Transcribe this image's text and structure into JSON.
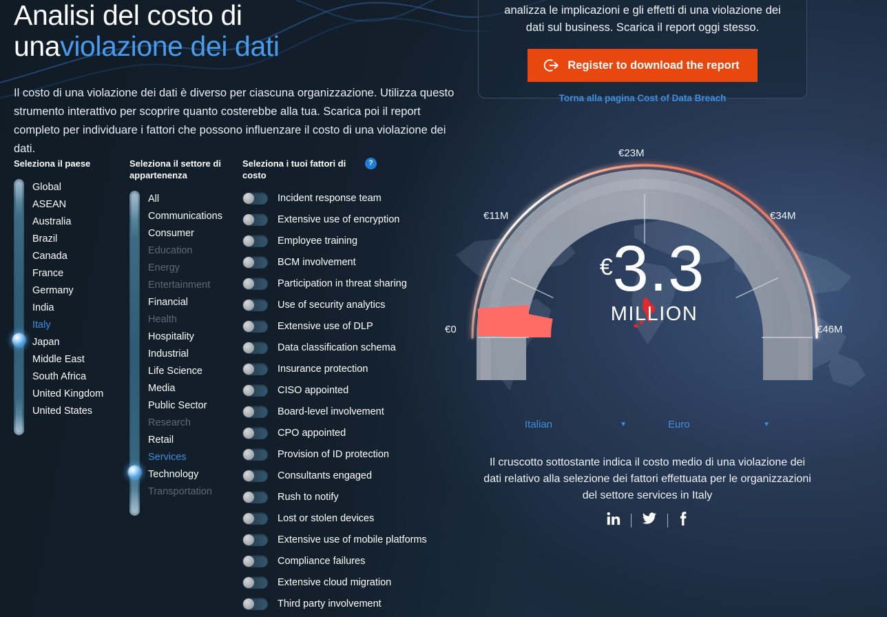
{
  "hero": {
    "title_line1": "Analisi del costo di",
    "title_line2_plain": "una",
    "title_line2_accent": "violazione dei dati",
    "lead": "Il costo di una violazione dei dati è diverso per ciascuna organizzazione. Utilizza questo strumento interattivo per scoprire quanto costerebbe alla tua. Scarica poi il report completo per individuare i fattori che possono influenzare il costo di una violazione dei dati."
  },
  "panel": {
    "text": "analizza le implicazioni e gli effetti di una violazione dei dati sul business. Scarica il report oggi stesso.",
    "button_label": "Register to download the report",
    "button_icon": "arrow-right-circle-icon",
    "button_color": "#e8470e",
    "link_label": "Torna alla pagina Cost of Data Breach",
    "link_color": "#3f8fe0"
  },
  "country": {
    "heading": "Seleziona il paese",
    "selected": "Italy",
    "items": [
      {
        "label": "Global",
        "state": "normal"
      },
      {
        "label": "ASEAN",
        "state": "normal"
      },
      {
        "label": "Australia",
        "state": "normal"
      },
      {
        "label": "Brazil",
        "state": "normal"
      },
      {
        "label": "Canada",
        "state": "normal"
      },
      {
        "label": "France",
        "state": "normal"
      },
      {
        "label": "Germany",
        "state": "normal"
      },
      {
        "label": "India",
        "state": "normal"
      },
      {
        "label": "Italy",
        "state": "selected"
      },
      {
        "label": "Japan",
        "state": "normal"
      },
      {
        "label": "Middle East",
        "state": "normal"
      },
      {
        "label": "South Africa",
        "state": "normal"
      },
      {
        "label": "United Kingdom",
        "state": "normal"
      },
      {
        "label": "United States",
        "state": "normal"
      }
    ]
  },
  "sector": {
    "heading": "Seleziona il settore di appartenenza",
    "selected": "Services",
    "items": [
      {
        "label": "All",
        "state": "normal"
      },
      {
        "label": "Communications",
        "state": "normal"
      },
      {
        "label": "Consumer",
        "state": "normal"
      },
      {
        "label": "Education",
        "state": "disabled"
      },
      {
        "label": "Energy",
        "state": "disabled"
      },
      {
        "label": "Entertainment",
        "state": "disabled"
      },
      {
        "label": "Financial",
        "state": "normal"
      },
      {
        "label": "Health",
        "state": "disabled"
      },
      {
        "label": "Hospitality",
        "state": "normal"
      },
      {
        "label": "Industrial",
        "state": "normal"
      },
      {
        "label": "Life Science",
        "state": "normal"
      },
      {
        "label": "Media",
        "state": "normal"
      },
      {
        "label": "Public Sector",
        "state": "normal"
      },
      {
        "label": "Research",
        "state": "disabled"
      },
      {
        "label": "Retail",
        "state": "normal"
      },
      {
        "label": "Services",
        "state": "selected"
      },
      {
        "label": "Technology",
        "state": "normal"
      },
      {
        "label": "Transportation",
        "state": "disabled"
      }
    ]
  },
  "factors": {
    "heading": "Seleziona i tuoi fattori di costo",
    "help_icon": "question-mark-icon",
    "items": [
      {
        "label": "Incident response team",
        "on": false
      },
      {
        "label": "Extensive use of encryption",
        "on": false
      },
      {
        "label": "Employee training",
        "on": false
      },
      {
        "label": "BCM involvement",
        "on": false
      },
      {
        "label": "Participation in threat sharing",
        "on": false
      },
      {
        "label": "Use of security analytics",
        "on": false
      },
      {
        "label": "Extensive use of DLP",
        "on": false
      },
      {
        "label": "Data classification schema",
        "on": false
      },
      {
        "label": "Insurance protection",
        "on": false
      },
      {
        "label": "CISO appointed",
        "on": false
      },
      {
        "label": "Board-level involvement",
        "on": false
      },
      {
        "label": "CPO appointed",
        "on": false
      },
      {
        "label": "Provision of ID protection",
        "on": false
      },
      {
        "label": "Consultants engaged",
        "on": false
      },
      {
        "label": "Rush to notify",
        "on": false
      },
      {
        "label": "Lost or stolen devices",
        "on": false
      },
      {
        "label": "Extensive use of mobile platforms",
        "on": false
      },
      {
        "label": "Compliance failures",
        "on": false
      },
      {
        "label": "Extensive cloud migration",
        "on": false
      },
      {
        "label": "Third party involvement",
        "on": false
      }
    ]
  },
  "gauge": {
    "currency_symbol": "€",
    "value_text": "3.3",
    "unit_text": "MILLION",
    "country_marker": "italy-silhouette",
    "fill_color": "#ff6b66"
  },
  "chart_data": {
    "type": "gauge",
    "title": "",
    "value": 3.3,
    "unit": "MILLION",
    "currency": "EUR",
    "currency_symbol": "€",
    "min": 0,
    "max": 46,
    "tick_values": [
      0,
      11,
      23,
      34,
      46
    ],
    "tick_labels": [
      "€0",
      "€11M",
      "€23M",
      "€34M",
      "€46M"
    ],
    "start_angle_deg": 180,
    "end_angle_deg": 360,
    "fill_color": "#ff6b66",
    "track_color": "#9aa3ae",
    "outer_arc_gradient": [
      "#ffffff",
      "#e8503a"
    ],
    "legend": [],
    "grid": false
  },
  "selectors": {
    "language": {
      "value": "Italian",
      "caret": "chevron-down-icon"
    },
    "currency": {
      "value": "Euro",
      "caret": "chevron-down-icon"
    }
  },
  "caption": "Il cruscotto sottostante indica il costo medio di una violazione dei dati relativo alla selezione dei fattori effettuata per le organizzazioni del settore services in Italy",
  "socials": [
    {
      "name": "linkedin-icon"
    },
    {
      "name": "twitter-icon"
    },
    {
      "name": "facebook-icon"
    }
  ]
}
